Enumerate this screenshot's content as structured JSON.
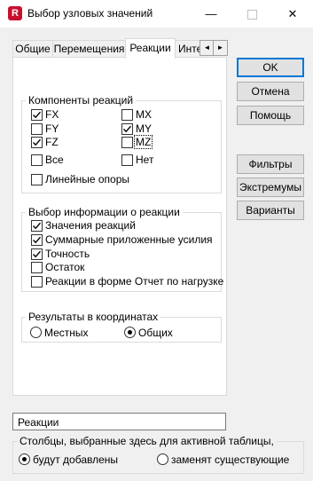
{
  "window": {
    "title": "Выбор узловых значений",
    "app_icon_letter": "R",
    "minimize_glyph": "—",
    "close_glyph": "✕"
  },
  "tabs": [
    {
      "label": "Общие",
      "active": false
    },
    {
      "label": "Перемещения",
      "active": false
    },
    {
      "label": "Реакции",
      "active": true
    },
    {
      "label": "Инте",
      "active": false
    }
  ],
  "tab_scroll": {
    "left": "◄",
    "right": "►"
  },
  "components": {
    "label": "Компоненты реакций",
    "items": [
      {
        "label": "FX",
        "checked": true
      },
      {
        "label": "MX",
        "checked": false
      },
      {
        "label": "FY",
        "checked": false
      },
      {
        "label": "MY",
        "checked": true
      },
      {
        "label": "FZ",
        "checked": true
      },
      {
        "label": "MZ",
        "checked": false
      },
      {
        "label": "Все",
        "checked": false
      },
      {
        "label": "Нет",
        "checked": false
      }
    ],
    "linear_supports": {
      "label": "Линейные опоры",
      "checked": false
    }
  },
  "info": {
    "label": "Выбор информации о реакции",
    "items": [
      {
        "label": "Значения реакций",
        "checked": true
      },
      {
        "label": "Суммарные приложенные усилия",
        "checked": true
      },
      {
        "label": "Точность",
        "checked": true
      },
      {
        "label": "Остаток",
        "checked": false
      },
      {
        "label": "Реакции в форме Отчет по нагрузке",
        "checked": false
      }
    ]
  },
  "coords": {
    "label": "Результаты в координатах",
    "options": [
      {
        "label": "Местных",
        "selected": false
      },
      {
        "label": "Общих",
        "selected": true
      }
    ]
  },
  "buttons": {
    "ok": "OK",
    "cancel": "Отмена",
    "help": "Помощь",
    "filters": "Фильтры",
    "extremes": "Экстремумы",
    "variants": "Варианты"
  },
  "table_name": {
    "value": "Реакции"
  },
  "columns": {
    "label": "Столбцы, выбранные здесь для активной таблицы,",
    "options": [
      {
        "label": "будут добавлены",
        "selected": true
      },
      {
        "label": "заменят существующие",
        "selected": false
      }
    ]
  },
  "colors": {
    "accent": "#0078d7",
    "brand": "#c8102e"
  }
}
